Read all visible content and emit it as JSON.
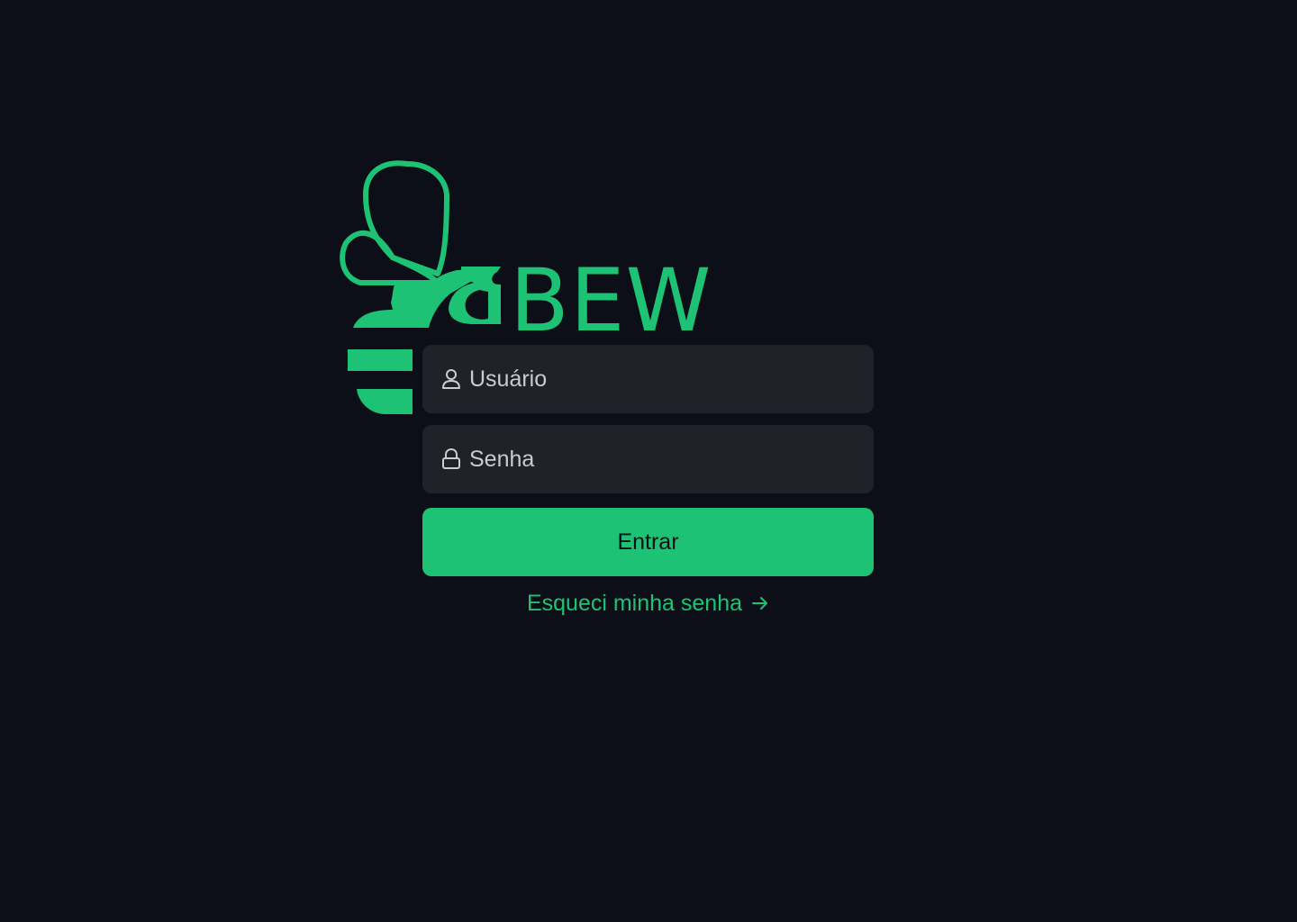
{
  "brand": {
    "name": "BEW",
    "logo_icon": "bee-icon",
    "accent_color": "#1ec275",
    "background_color": "#0c0f17"
  },
  "login": {
    "username_placeholder": "Usuário",
    "username_icon": "user-icon",
    "password_placeholder": "Senha",
    "password_icon": "lock-icon",
    "submit_label": "Entrar",
    "forgot_label": "Esqueci minha senha",
    "forgot_icon": "arrow-right-icon"
  }
}
